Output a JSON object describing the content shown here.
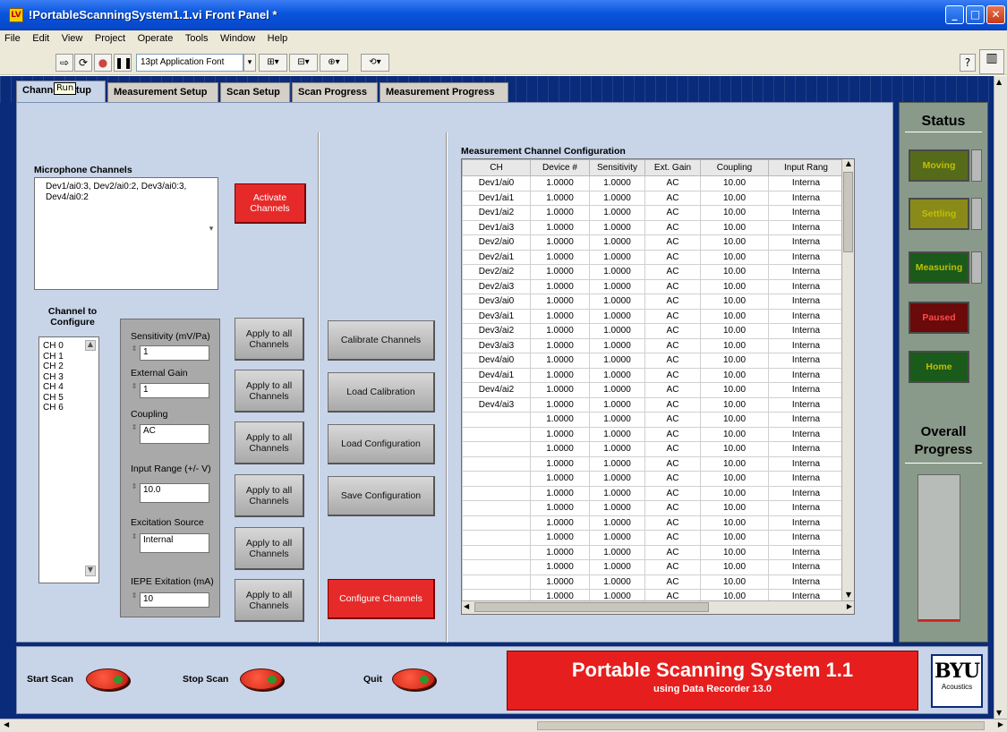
{
  "window": {
    "title": "!PortableScanningSystem1.1.vi Front Panel *",
    "icon_text": "LV"
  },
  "menu": [
    "File",
    "Edit",
    "View",
    "Project",
    "Operate",
    "Tools",
    "Window",
    "Help"
  ],
  "toolbar": {
    "font_select": "13pt Application Font",
    "tooltip": "Run"
  },
  "tabs": [
    "Channel Setup",
    "Measurement Setup",
    "Scan Setup",
    "Scan Progress",
    "Measurement Progress"
  ],
  "left": {
    "mic_channels_label": "Microphone Channels",
    "mic_channels_value": "Dev1/ai0:3, Dev2/ai0:2, Dev3/ai0:3, Dev4/ai0:2",
    "activate_label": "Activate Channels",
    "channel_to_configure_label": "Channel to Configure",
    "channels": [
      "CH 0",
      "CH 1",
      "CH 2",
      "CH 3",
      "CH 4",
      "CH 5",
      "CH 6"
    ],
    "sensitivity_label": "Sensitivity (mV/Pa)",
    "sensitivity_value": "1",
    "ext_gain_label": "External Gain",
    "ext_gain_value": "1",
    "coupling_label": "Coupling",
    "coupling_value": "AC",
    "input_range_label": "Input Range (+/- V)",
    "input_range_value": "10.0",
    "excitation_label": "Excitation Source",
    "excitation_value": "Internal",
    "iepe_label": "IEPE Exitation (mA)",
    "iepe_value": "10",
    "apply_label": "Apply to all Channels"
  },
  "middle": {
    "calibrate": "Calibrate Channels",
    "load_cal": "Load Calibration",
    "load_config": "Load Configuration",
    "save_config": "Save Configuration",
    "configure": "Configure Channels"
  },
  "table": {
    "title": "Measurement Channel Configuration",
    "headers": [
      "CH",
      "Device #",
      "Sensitivity",
      "Ext. Gain",
      "Coupling",
      "Input Rang"
    ],
    "rows": [
      [
        "Dev1/ai0",
        "1.0000",
        "1.0000",
        "AC",
        "10.00",
        "Interna"
      ],
      [
        "Dev1/ai1",
        "1.0000",
        "1.0000",
        "AC",
        "10.00",
        "Interna"
      ],
      [
        "Dev1/ai2",
        "1.0000",
        "1.0000",
        "AC",
        "10.00",
        "Interna"
      ],
      [
        "Dev1/ai3",
        "1.0000",
        "1.0000",
        "AC",
        "10.00",
        "Interna"
      ],
      [
        "Dev2/ai0",
        "1.0000",
        "1.0000",
        "AC",
        "10.00",
        "Interna"
      ],
      [
        "Dev2/ai1",
        "1.0000",
        "1.0000",
        "AC",
        "10.00",
        "Interna"
      ],
      [
        "Dev2/ai2",
        "1.0000",
        "1.0000",
        "AC",
        "10.00",
        "Interna"
      ],
      [
        "Dev2/ai3",
        "1.0000",
        "1.0000",
        "AC",
        "10.00",
        "Interna"
      ],
      [
        "Dev3/ai0",
        "1.0000",
        "1.0000",
        "AC",
        "10.00",
        "Interna"
      ],
      [
        "Dev3/ai1",
        "1.0000",
        "1.0000",
        "AC",
        "10.00",
        "Interna"
      ],
      [
        "Dev3/ai2",
        "1.0000",
        "1.0000",
        "AC",
        "10.00",
        "Interna"
      ],
      [
        "Dev3/ai3",
        "1.0000",
        "1.0000",
        "AC",
        "10.00",
        "Interna"
      ],
      [
        "Dev4/ai0",
        "1.0000",
        "1.0000",
        "AC",
        "10.00",
        "Interna"
      ],
      [
        "Dev4/ai1",
        "1.0000",
        "1.0000",
        "AC",
        "10.00",
        "Interna"
      ],
      [
        "Dev4/ai2",
        "1.0000",
        "1.0000",
        "AC",
        "10.00",
        "Interna"
      ],
      [
        "Dev4/ai3",
        "1.0000",
        "1.0000",
        "AC",
        "10.00",
        "Interna"
      ],
      [
        "",
        "1.0000",
        "1.0000",
        "AC",
        "10.00",
        "Interna"
      ],
      [
        "",
        "1.0000",
        "1.0000",
        "AC",
        "10.00",
        "Interna"
      ],
      [
        "",
        "1.0000",
        "1.0000",
        "AC",
        "10.00",
        "Interna"
      ],
      [
        "",
        "1.0000",
        "1.0000",
        "AC",
        "10.00",
        "Interna"
      ],
      [
        "",
        "1.0000",
        "1.0000",
        "AC",
        "10.00",
        "Interna"
      ],
      [
        "",
        "1.0000",
        "1.0000",
        "AC",
        "10.00",
        "Interna"
      ],
      [
        "",
        "1.0000",
        "1.0000",
        "AC",
        "10.00",
        "Interna"
      ],
      [
        "",
        "1.0000",
        "1.0000",
        "AC",
        "10.00",
        "Interna"
      ],
      [
        "",
        "1.0000",
        "1.0000",
        "AC",
        "10.00",
        "Interna"
      ],
      [
        "",
        "1.0000",
        "1.0000",
        "AC",
        "10.00",
        "Interna"
      ],
      [
        "",
        "1.0000",
        "1.0000",
        "AC",
        "10.00",
        "Interna"
      ],
      [
        "",
        "1.0000",
        "1.0000",
        "AC",
        "10.00",
        "Interna"
      ],
      [
        "",
        "1.0000",
        "1.0000",
        "AC",
        "10.00",
        "Interna"
      ]
    ]
  },
  "status": {
    "title": "Status",
    "items": [
      {
        "label": "Moving",
        "color": "#556b1a"
      },
      {
        "label": "Settling",
        "color": "#8a8a1a"
      },
      {
        "label": "Measuring",
        "color": "#1a5a1a"
      },
      {
        "label": "Paused",
        "color": "#6a0a0a"
      },
      {
        "label": "Home",
        "color": "#1a5a1a"
      }
    ],
    "overall_progress_label": "Overall Progress",
    "overall_progress_value": 0
  },
  "bottom": {
    "start_scan": "Start Scan",
    "stop_scan": "Stop Scan",
    "quit": "Quit",
    "banner_title": "Portable Scanning System 1.1",
    "banner_subtitle": "using Data Recorder 13.0",
    "logo_top": "BYU",
    "logo_bottom": "Acoustics"
  }
}
